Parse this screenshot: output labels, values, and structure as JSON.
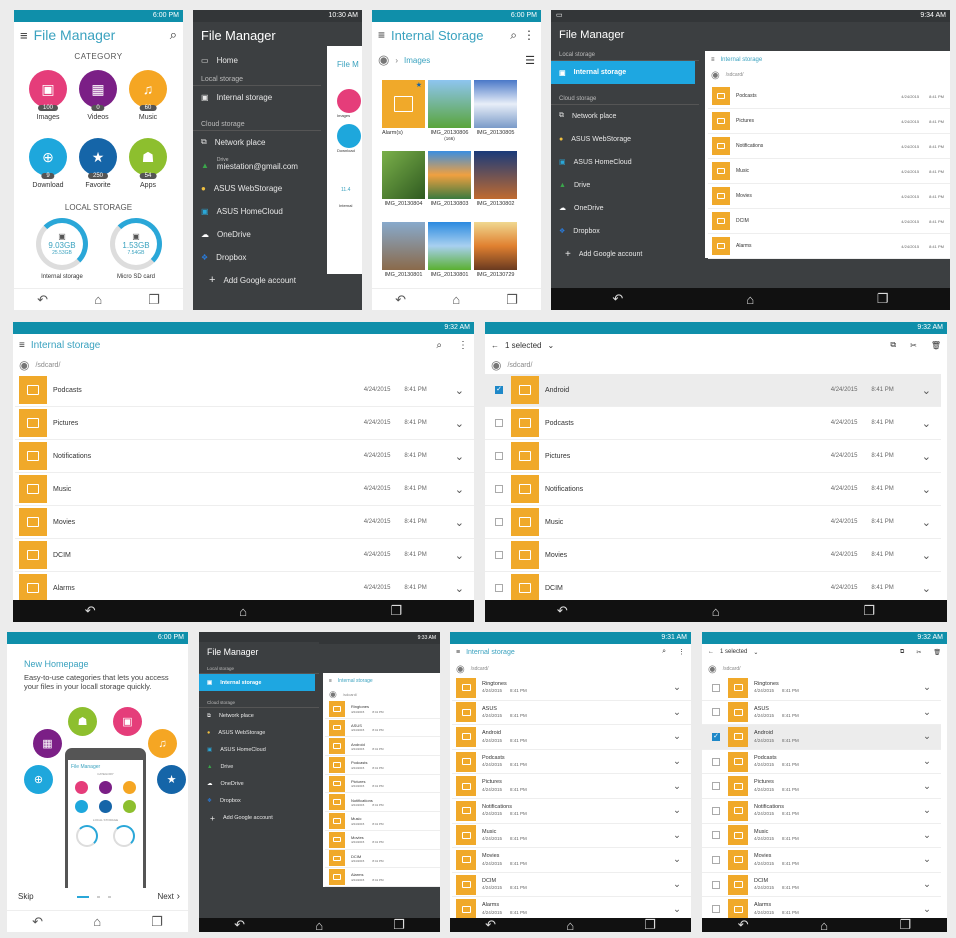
{
  "colors": {
    "status_bar": "#0f8faa",
    "accent": "#3aa2bf",
    "folder": "#f0a92a",
    "drawer": "#3c3f41",
    "drawer_selected": "#1ea7e1"
  },
  "nav_icons": [
    "back-icon",
    "home-icon",
    "recent-apps-icon"
  ],
  "p1": {
    "time": "6:00 PM",
    "title": "File Manager",
    "category_header": "CATEGORY",
    "categories": [
      {
        "label": "Images",
        "count": "100",
        "color": "#e53d7a",
        "icon": "image-icon",
        "glyph": "▣"
      },
      {
        "label": "Videos",
        "count": "0",
        "color": "#7b1f86",
        "icon": "film-icon",
        "glyph": "▦"
      },
      {
        "label": "Music",
        "count": "60",
        "color": "#f5a623",
        "icon": "music-icon",
        "glyph": "♫"
      },
      {
        "label": "Download",
        "count": "9",
        "color": "#1ea7dc",
        "icon": "download-icon",
        "glyph": "⊕"
      },
      {
        "label": "Favorite",
        "count": "250",
        "color": "#1565a8",
        "icon": "star-icon",
        "glyph": "★"
      },
      {
        "label": "Apps",
        "count": "54",
        "color": "#8dbf2e",
        "icon": "android-icon",
        "glyph": "☗"
      }
    ],
    "local_header": "LOCAL STORAGE",
    "storages": [
      {
        "label": "Internal storage",
        "used": "9.03GB",
        "total": "25.53GB"
      },
      {
        "label": "Micro SD card",
        "used": "1.53GB",
        "total": "7.54GB"
      }
    ]
  },
  "p2": {
    "time": "10:30 AM",
    "title": "File Manager",
    "home": "Home",
    "local_section": "Local storage",
    "internal": "Internal storage",
    "cloud_section": "Cloud storage",
    "cloud": [
      {
        "label": "Network place",
        "icon": "network-place-icon"
      },
      {
        "label": "miestation@gmail.com",
        "sub": "Drive",
        "icon": "drive-icon"
      },
      {
        "label": "ASUS WebStorage",
        "icon": "webstorage-icon"
      },
      {
        "label": "ASUS HomeCloud",
        "icon": "homecloud-icon"
      },
      {
        "label": "OneDrive",
        "icon": "onedrive-icon"
      },
      {
        "label": "Dropbox",
        "icon": "dropbox-icon"
      }
    ],
    "add_account": "Add Google account",
    "peek": {
      "title": "File M",
      "images": "Images",
      "download": "Download",
      "used": "11.4",
      "storage": "Internal"
    }
  },
  "p3": {
    "time": "6:00 PM",
    "title": "Internal Storage",
    "breadcrumb": "Images",
    "items": [
      {
        "label": "Alarm(s)",
        "type": "folder"
      },
      {
        "label": "IMG_20130806",
        "sub": "(166)",
        "bg": "linear-gradient(#8ec5f0,#5aa53a)"
      },
      {
        "label": "IMG_20130805",
        "bg": "linear-gradient(#4a78c8,#e8eef8,#7a9ac8)"
      },
      {
        "label": "IMG_20130804",
        "bg": "linear-gradient(135deg,#7ab04a,#2f5a20)"
      },
      {
        "label": "IMG_20130803",
        "bg": "linear-gradient(#3a8ee0,#f0a040,#3a7a40)"
      },
      {
        "label": "IMG_20130802",
        "bg": "linear-gradient(#1a3a7a,#c06a30)"
      },
      {
        "label": "IMG_20130801",
        "bg": "linear-gradient(#88aacc,#8a6a4a)"
      },
      {
        "label": "IMG_20130801",
        "bg": "linear-gradient(#2a8ae0,#a8d0f0,#5ab030)"
      },
      {
        "label": "IMG_20130729",
        "bg": "linear-gradient(#f0d890,#e08030,#6a3a20)"
      }
    ]
  },
  "p4": {
    "time": "9:34 AM",
    "title": "File Manager",
    "local_section": "Local storage",
    "internal": "Internal storage",
    "cloud_section": "Cloud storage",
    "cloud": [
      {
        "label": "Network place",
        "icon": "network-place-icon"
      },
      {
        "label": "ASUS WebStorage",
        "icon": "webstorage-icon"
      },
      {
        "label": "ASUS HomeCloud",
        "icon": "homecloud-icon"
      },
      {
        "label": "Drive",
        "icon": "drive-icon"
      },
      {
        "label": "OneDrive",
        "icon": "onedrive-icon"
      },
      {
        "label": "Dropbox",
        "icon": "dropbox-icon"
      }
    ],
    "add_account": "Add Google account",
    "list_title": "Internal storage",
    "path": "/sdcard/",
    "folders": [
      {
        "name": "Podcasts",
        "date": "4/24/2015",
        "time": "8:41 PM"
      },
      {
        "name": "Pictures",
        "date": "4/24/2015",
        "time": "8:41 PM"
      },
      {
        "name": "Notifications",
        "date": "4/24/2015",
        "time": "8:41 PM"
      },
      {
        "name": "Music",
        "date": "4/24/2015",
        "time": "8:41 PM"
      },
      {
        "name": "Movies",
        "date": "4/24/2015",
        "time": "8:41 PM"
      },
      {
        "name": "DCIM",
        "date": "4/24/2015",
        "time": "8:41 PM"
      },
      {
        "name": "Alarms",
        "date": "4/24/2015",
        "time": "8:41 PM"
      }
    ]
  },
  "p5": {
    "time": "9:32 AM",
    "title": "Internal storage",
    "path": "/sdcard/",
    "folders": [
      {
        "name": "Podcasts",
        "date": "4/24/2015",
        "time": "8:41 PM"
      },
      {
        "name": "Pictures",
        "date": "4/24/2015",
        "time": "8:41 PM"
      },
      {
        "name": "Notifications",
        "date": "4/24/2015",
        "time": "8:41 PM"
      },
      {
        "name": "Music",
        "date": "4/24/2015",
        "time": "8:41 PM"
      },
      {
        "name": "Movies",
        "date": "4/24/2015",
        "time": "8:41 PM"
      },
      {
        "name": "DCIM",
        "date": "4/24/2015",
        "time": "8:41 PM"
      },
      {
        "name": "Alarms",
        "date": "4/24/2015",
        "time": "8:41 PM"
      }
    ]
  },
  "p6": {
    "time": "9:32 AM",
    "selection": "1 selected",
    "path": "/sdcard/",
    "folders": [
      {
        "name": "Android",
        "date": "4/24/2015",
        "time": "8:41 PM",
        "checked": true
      },
      {
        "name": "Podcasts",
        "date": "4/24/2015",
        "time": "8:41 PM"
      },
      {
        "name": "Pictures",
        "date": "4/24/2015",
        "time": "8:41 PM"
      },
      {
        "name": "Notifications",
        "date": "4/24/2015",
        "time": "8:41 PM"
      },
      {
        "name": "Music",
        "date": "4/24/2015",
        "time": "8:41 PM"
      },
      {
        "name": "Movies",
        "date": "4/24/2015",
        "time": "8:41 PM"
      },
      {
        "name": "DCIM",
        "date": "4/24/2015",
        "time": "8:41 PM"
      }
    ]
  },
  "p7": {
    "time": "6:00 PM",
    "heading": "New Homepage",
    "description": "Easy-to-use categories that lets you access your files in your locall storage quickly.",
    "skip": "Skip",
    "next": "Next",
    "mock_title": "File Manager",
    "mock_category": "CATEGORY",
    "mock_local": "LOCAL STORAGE",
    "page": 1,
    "pages": 3
  },
  "p8": {
    "time": "9:33 AM",
    "title": "File Manager",
    "local_section": "Local storage",
    "internal": "Internal storage",
    "cloud_section": "Cloud storage",
    "cloud": [
      {
        "label": "Network place",
        "icon": "network-place-icon"
      },
      {
        "label": "ASUS WebStorage",
        "icon": "webstorage-icon"
      },
      {
        "label": "ASUS HomeCloud",
        "icon": "homecloud-icon"
      },
      {
        "label": "Drive",
        "icon": "drive-icon"
      },
      {
        "label": "OneDrive",
        "icon": "onedrive-icon"
      },
      {
        "label": "Dropbox",
        "icon": "dropbox-icon"
      }
    ],
    "add_account": "Add Google account",
    "list_title": "Internal storage",
    "path": "/sdcard/",
    "folders": [
      {
        "name": "Ringtones",
        "date": "4/24/2015",
        "time": "8:41 PM"
      },
      {
        "name": "ASUS",
        "date": "4/24/2015",
        "time": "8:41 PM"
      },
      {
        "name": "Android",
        "date": "4/24/2015",
        "time": "8:41 PM"
      },
      {
        "name": "Podcasts",
        "date": "4/24/2015",
        "time": "8:41 PM"
      },
      {
        "name": "Pictures",
        "date": "4/24/2015",
        "time": "8:41 PM"
      },
      {
        "name": "Notifications",
        "date": "4/24/2015",
        "time": "8:41 PM"
      },
      {
        "name": "Music",
        "date": "4/24/2015",
        "time": "8:41 PM"
      },
      {
        "name": "Movies",
        "date": "4/24/2015",
        "time": "8:41 PM"
      },
      {
        "name": "DCIM",
        "date": "4/24/2015",
        "time": "8:41 PM"
      },
      {
        "name": "Alarms",
        "date": "4/24/2015",
        "time": "8:41 PM"
      }
    ]
  },
  "p9": {
    "time": "9:31 AM",
    "title": "Internal storage",
    "path": "/sdcard/",
    "folders": [
      {
        "name": "Ringtones",
        "date": "4/24/2015",
        "time": "8:41 PM"
      },
      {
        "name": "ASUS",
        "date": "4/24/2015",
        "time": "8:41 PM"
      },
      {
        "name": "Android",
        "date": "4/24/2015",
        "time": "8:41 PM"
      },
      {
        "name": "Podcasts",
        "date": "4/24/2015",
        "time": "8:41 PM"
      },
      {
        "name": "Pictures",
        "date": "4/24/2015",
        "time": "8:41 PM"
      },
      {
        "name": "Notifications",
        "date": "4/24/2015",
        "time": "8:41 PM"
      },
      {
        "name": "Music",
        "date": "4/24/2015",
        "time": "8:41 PM"
      },
      {
        "name": "Movies",
        "date": "4/24/2015",
        "time": "8:41 PM"
      },
      {
        "name": "DCIM",
        "date": "4/24/2015",
        "time": "8:41 PM"
      },
      {
        "name": "Alarms",
        "date": "4/24/2015",
        "time": "8:41 PM"
      }
    ]
  },
  "p10": {
    "time": "9:32 AM",
    "selection": "1 selected",
    "path": "/sdcard/",
    "folders": [
      {
        "name": "Ringtones",
        "date": "4/24/2015",
        "time": "8:41 PM"
      },
      {
        "name": "ASUS",
        "date": "4/24/2015",
        "time": "8:41 PM"
      },
      {
        "name": "Android",
        "date": "4/24/2015",
        "time": "8:41 PM",
        "checked": true
      },
      {
        "name": "Podcasts",
        "date": "4/24/2015",
        "time": "8:41 PM"
      },
      {
        "name": "Pictures",
        "date": "4/24/2015",
        "time": "8:41 PM"
      },
      {
        "name": "Notifications",
        "date": "4/24/2015",
        "time": "8:41 PM"
      },
      {
        "name": "Music",
        "date": "4/24/2015",
        "time": "8:41 PM"
      },
      {
        "name": "Movies",
        "date": "4/24/2015",
        "time": "8:41 PM"
      },
      {
        "name": "DCIM",
        "date": "4/24/2015",
        "time": "8:41 PM"
      },
      {
        "name": "Alarms",
        "date": "4/24/2015",
        "time": "8:41 PM"
      }
    ]
  }
}
